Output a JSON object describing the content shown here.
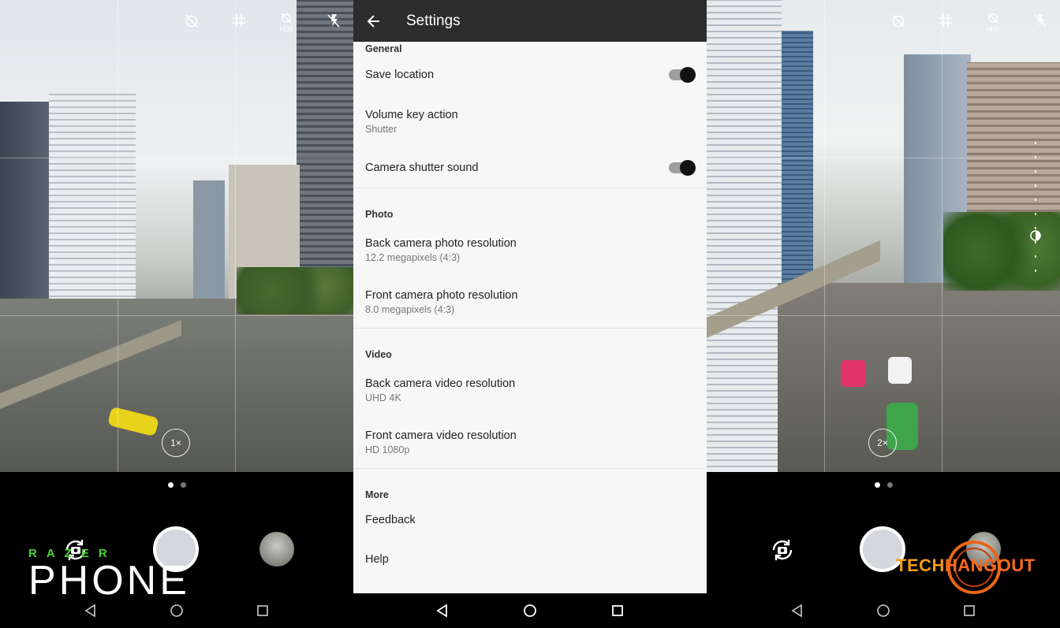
{
  "settings": {
    "title": "Settings",
    "sections": [
      {
        "header": "General",
        "rows": [
          {
            "label": "Save location",
            "sub": "",
            "toggle": true
          },
          {
            "label": "Volume key action",
            "sub": "Shutter",
            "toggle": false
          },
          {
            "label": "Camera shutter sound",
            "sub": "",
            "toggle": true
          }
        ]
      },
      {
        "header": "Photo",
        "rows": [
          {
            "label": "Back camera photo resolution",
            "sub": "12.2 megapixels (4:3)"
          },
          {
            "label": "Front camera photo resolution",
            "sub": "8.0 megapixels (4:3)"
          }
        ]
      },
      {
        "header": "Video",
        "rows": [
          {
            "label": "Back camera video resolution",
            "sub": "UHD 4K"
          },
          {
            "label": "Front camera video resolution",
            "sub": "HD 1080p"
          }
        ]
      },
      {
        "header": "More",
        "rows": [
          {
            "label": "Feedback",
            "sub": ""
          },
          {
            "label": "Help",
            "sub": ""
          }
        ]
      }
    ]
  },
  "camera_left": {
    "zoom_label": "1×",
    "hdr_label": "HDR"
  },
  "camera_right": {
    "zoom_label": "2×",
    "hdr_label": "HDR"
  },
  "watermarks": {
    "razer_brand": "RAZER",
    "razer_product": "PHONE",
    "tech_part": "TECH",
    "hangout_part": "HANGOUT"
  },
  "colors": {
    "appbar": "#2c2c2c",
    "razer_green": "#44d62c",
    "techhangout_orange": "#f39c12"
  }
}
